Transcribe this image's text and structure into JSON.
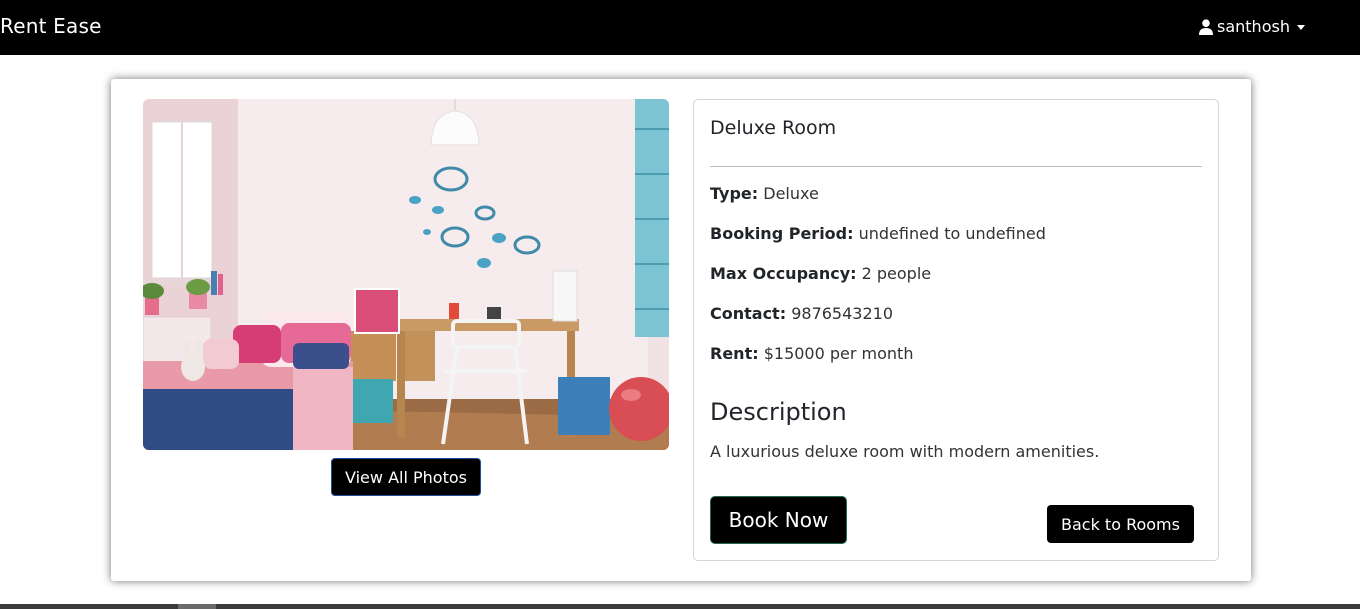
{
  "navbar": {
    "brand": "Rent Ease",
    "user": {
      "name": "santhosh",
      "icon": "user-icon"
    }
  },
  "gallery": {
    "image_alt": "Deluxe Room photo",
    "view_photos_label": "View All Photos"
  },
  "room": {
    "title": "Deluxe Room",
    "fields": [
      {
        "label": "Type:",
        "value": "Deluxe"
      },
      {
        "label": "Booking Period:",
        "value": "undefined to undefined"
      },
      {
        "label": "Max Occupancy:",
        "value": "2 people"
      },
      {
        "label": "Contact:",
        "value": "9876543210"
      },
      {
        "label": "Rent:",
        "value": "$15000 per month"
      }
    ],
    "description_heading": "Description",
    "description": "A luxurious deluxe room with modern amenities."
  },
  "actions": {
    "book_label": "Book Now",
    "back_label": "Back to Rooms"
  },
  "colors": {
    "navbar_bg": "#000000",
    "button_bg": "#000000",
    "button_text": "#ffffff"
  }
}
